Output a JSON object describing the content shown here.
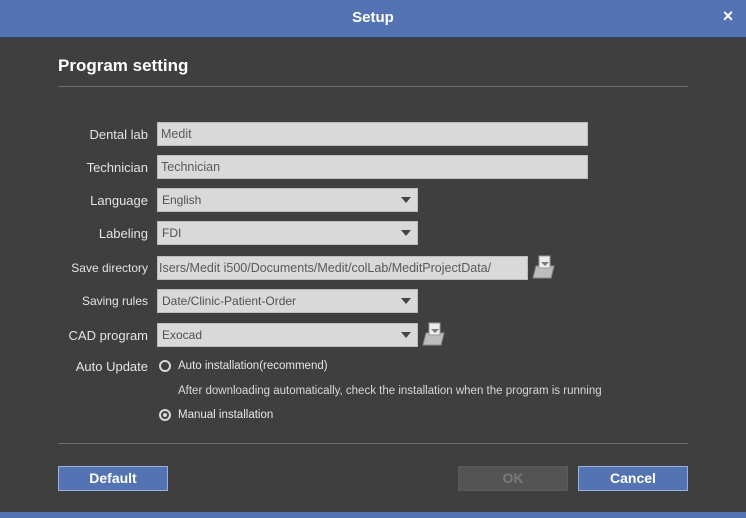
{
  "window": {
    "title": "Setup",
    "close_symbol": "×"
  },
  "section": {
    "title": "Program setting"
  },
  "fields": {
    "dental_lab": {
      "label": "Dental lab",
      "value": "Medit"
    },
    "technician": {
      "label": "Technician",
      "value": "Technician"
    },
    "language": {
      "label": "Language",
      "value": "English"
    },
    "labeling": {
      "label": "Labeling",
      "value": "FDI"
    },
    "save_directory": {
      "label": "Save directory",
      "value": "Isers/Medit i500/Documents/Medit/colLab/MeditProjectData/"
    },
    "saving_rules": {
      "label": "Saving rules",
      "value": "Date/Clinic-Patient-Order"
    },
    "cad_program": {
      "label": "CAD program",
      "value": "Exocad"
    }
  },
  "auto_update": {
    "label": "Auto Update",
    "options": [
      {
        "label": "Auto installation(recommend)",
        "checked": false
      },
      {
        "label": "Manual installation",
        "checked": true
      }
    ],
    "hint": "After downloading automatically, check the installation when the program is running"
  },
  "buttons": {
    "default": "Default",
    "ok": "OK",
    "cancel": "Cancel"
  },
  "icons": {
    "folder": "folder-browse-icon"
  },
  "colors": {
    "accent": "#5473b3",
    "background": "#3f3f3f",
    "field": "#d9d9d9"
  }
}
